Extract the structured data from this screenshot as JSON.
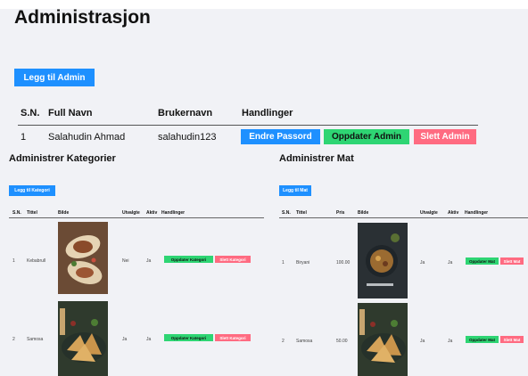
{
  "page_title": "Administrasjon",
  "add_admin_label": "Legg til Admin",
  "admin_table": {
    "headers": [
      "S.N.",
      "Full Navn",
      "Brukernavn",
      "Handlinger"
    ],
    "rows": [
      {
        "sn": "1",
        "full_name": "Salahudin Ahmad",
        "username": "salahudin123"
      }
    ],
    "actions": {
      "change_password": "Endre Passord",
      "update_admin": "Oppdater Admin",
      "delete_admin": "Slett Admin"
    }
  },
  "categories": {
    "title": "Administrer Kategorier",
    "add_label": "Legg til Kategori",
    "headers": [
      "S.N.",
      "Tittel",
      "Bilde",
      "Utvalgte",
      "Aktiv",
      "Handlinger"
    ],
    "rows": [
      {
        "sn": "1",
        "title": "Kebabrull",
        "image": "kebab-wrap-image",
        "featured": "Nei",
        "active": "Ja"
      },
      {
        "sn": "2",
        "title": "Samosa",
        "image": "samosa-image",
        "featured": "Ja",
        "active": "Ja"
      }
    ],
    "update_label": "Oppdater Kategori",
    "delete_label": "Slett Kategori"
  },
  "foods": {
    "title": "Administrer Mat",
    "add_label": "Legg til Mat",
    "headers": [
      "S.N.",
      "Tittel",
      "Pris",
      "Bilde",
      "Utvalgte",
      "Aktiv",
      "Handlinger"
    ],
    "rows": [
      {
        "sn": "1",
        "title": "Biryani",
        "price": "100.00",
        "image": "biryani-image",
        "featured": "Ja",
        "active": "Ja"
      },
      {
        "sn": "2",
        "title": "Samosa",
        "price": "50.00",
        "image": "samosa-image",
        "featured": "Ja",
        "active": "Ja"
      }
    ],
    "update_label": "Oppdater Mat",
    "delete_label": "Slett Mat"
  },
  "colors": {
    "primary": "#1e90ff",
    "success": "#2ed573",
    "danger": "#ff6b81",
    "background": "#f1f2f6"
  }
}
